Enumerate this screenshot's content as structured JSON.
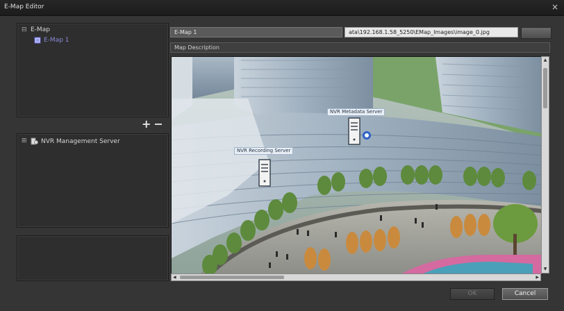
{
  "window": {
    "title": "E-Map Editor"
  },
  "emap_tree": {
    "root_label": "E-Map",
    "child_label": "E-Map 1"
  },
  "server_tree": {
    "root_label": "NVR Management Server"
  },
  "tree_actions": {
    "add": "+",
    "remove": "−"
  },
  "map_form": {
    "name": "E-Map 1",
    "image_path": "ata\\192.168.1.58_5250\\EMap_Images\\image_0.jpg",
    "description_placeholder": "Map Description"
  },
  "map_markers": [
    {
      "label": "NVR Metadata Server"
    },
    {
      "label": "NVR Recording Server"
    }
  ],
  "buttons": {
    "ok": "OK",
    "cancel": "Cancel"
  },
  "colors": {
    "selected_tree_item": "#8a8ad8",
    "window_bg": "#353535"
  }
}
